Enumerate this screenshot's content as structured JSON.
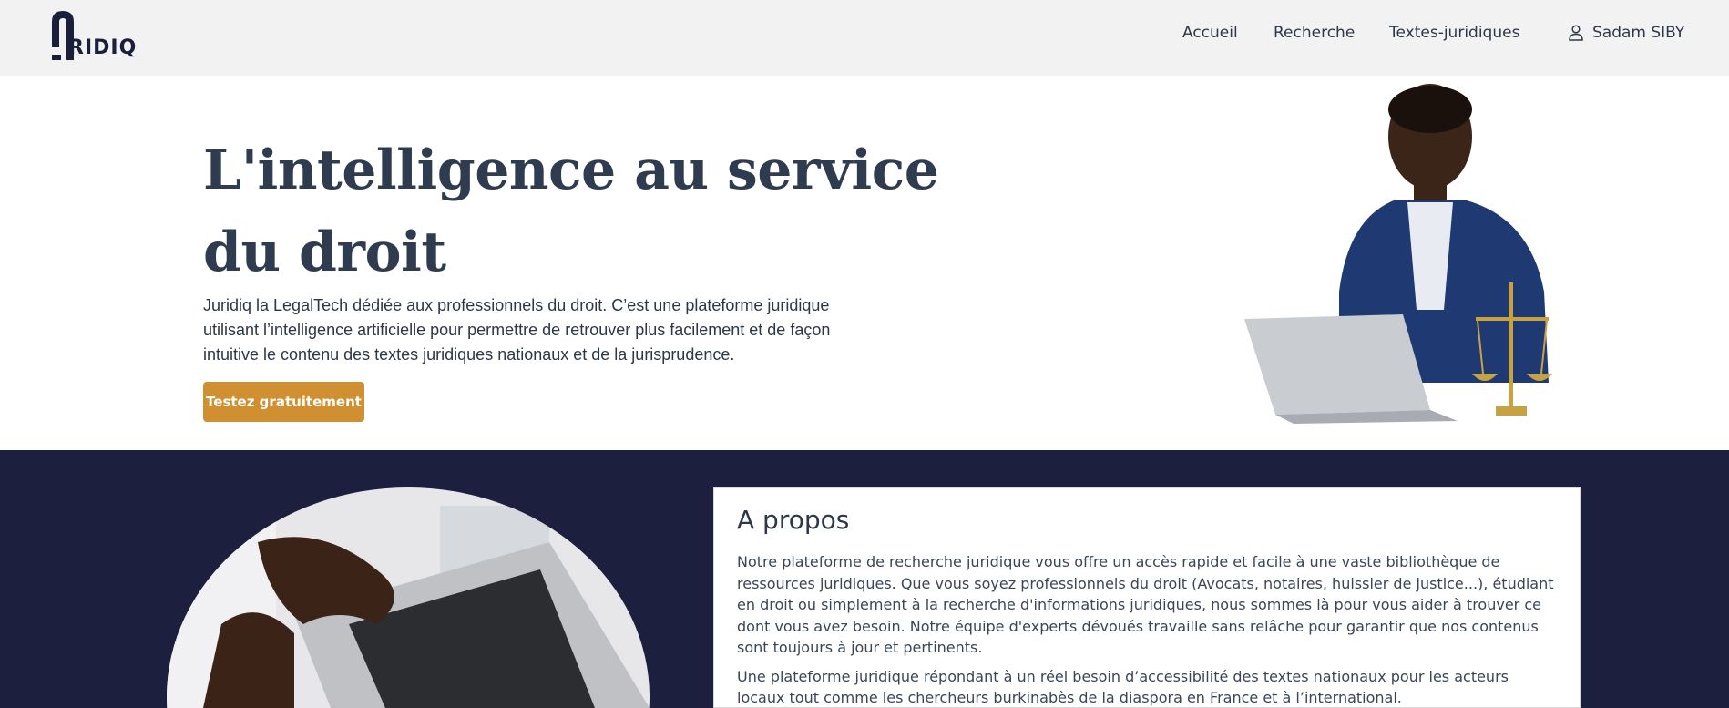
{
  "header": {
    "logo_text": "RIDIQ",
    "nav": [
      "Accueil",
      "Recherche",
      "Textes-juridiques"
    ],
    "user_name": "Sadam SIBY"
  },
  "hero": {
    "title": "L'intelligence au service du droit",
    "description": "Juridiq la LegalTech dédiée aux professionnels du droit. C’est une plateforme juridique utilisant l’intelligence artificielle pour permettre de retrouver plus facilement et de façon intuitive le contenu des textes juridiques nationaux et de la jurisprudence.",
    "cta_label": "Testez gratuitement"
  },
  "about": {
    "title": "A propos",
    "paragraph1": "Notre plateforme de recherche juridique vous offre un accès rapide et facile à une vaste bibliothèque de ressources juridiques. Que vous soyez professionnels du droit (Avocats, notaires, huissier de justice...), étudiant en droit ou simplement à la recherche d'informations juridiques, nous sommes là pour vous aider à trouver ce dont vous avez besoin. Notre équipe d'experts dévoués travaille sans relâche pour garantir que nos contenus sont toujours à jour et pertinents.",
    "paragraph2": "Une plateforme juridique répondant à un réel besoin d’accessibilité des textes nationaux pour les acteurs locaux tout comme les chercheurs burkinabès de la diaspora en France et à l’international."
  },
  "colors": {
    "header_bg": "#f2f2f2",
    "accent": "#d08f30",
    "dark_section": "#1c1f3e",
    "title": "#2f3c50"
  },
  "icons": [
    "juridiq-logo-icon",
    "user-icon"
  ]
}
